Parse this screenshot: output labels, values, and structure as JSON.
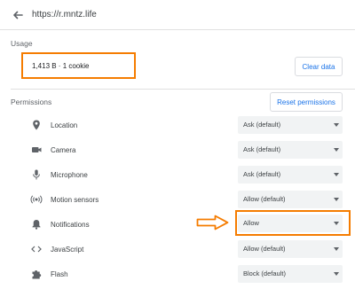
{
  "header": {
    "url": "https://r.mntz.life",
    "back_icon": "arrow-left-icon"
  },
  "usage": {
    "label": "Usage",
    "value": "1,413 B · 1 cookie",
    "clear_button": "Clear data"
  },
  "permissions": {
    "label": "Permissions",
    "reset_button": "Reset permissions",
    "items": [
      {
        "label": "Location",
        "icon": "location-pin-icon",
        "value": "Ask (default)"
      },
      {
        "label": "Camera",
        "icon": "camera-icon",
        "value": "Ask (default)"
      },
      {
        "label": "Microphone",
        "icon": "microphone-icon",
        "value": "Ask (default)"
      },
      {
        "label": "Motion sensors",
        "icon": "motion-sensors-icon",
        "value": "Allow (default)"
      },
      {
        "label": "Notifications",
        "icon": "bell-icon",
        "value": "Allow"
      },
      {
        "label": "JavaScript",
        "icon": "code-brackets-icon",
        "value": "Allow (default)"
      },
      {
        "label": "Flash",
        "icon": "puzzle-icon",
        "value": "Block (default)"
      }
    ]
  },
  "colors": {
    "highlight": "#f57c00",
    "link": "#1a73e8"
  }
}
